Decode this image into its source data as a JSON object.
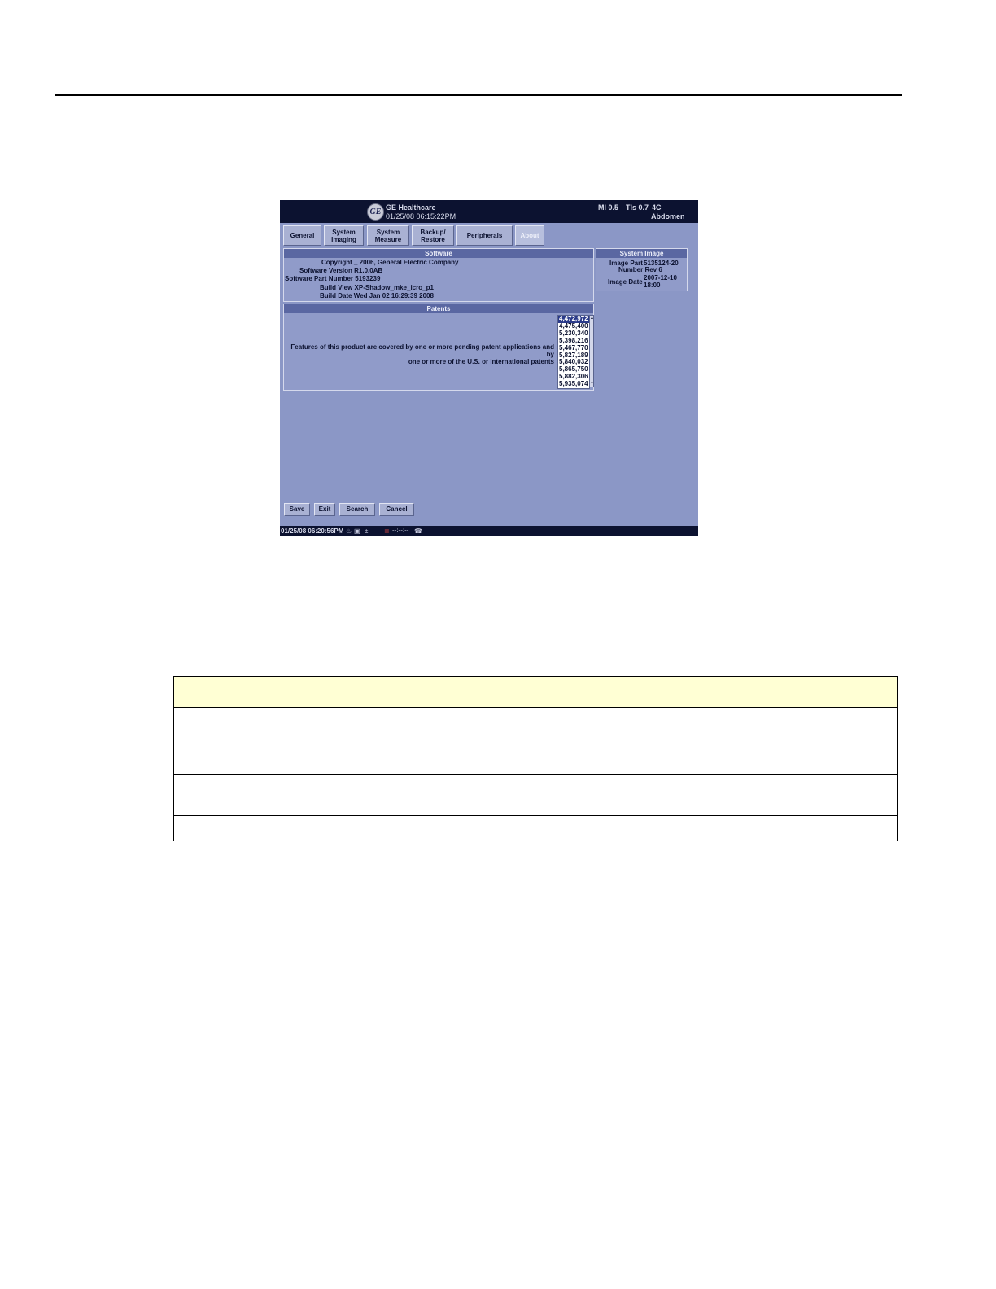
{
  "screenshot": {
    "header": {
      "brand": "GE Healthcare",
      "datetime": "01/25/08 06:15:22PM",
      "mi": "MI 0.5",
      "tis": "TIs 0.7",
      "probe": "4C",
      "preset": "Abdomen",
      "logo": "GE"
    },
    "tabs": [
      {
        "label": "General",
        "active": false
      },
      {
        "label": "System\nImaging",
        "active": false
      },
      {
        "label": "System\nMeasure",
        "active": false
      },
      {
        "label": "Backup/\nRestore",
        "active": false
      },
      {
        "label": "Peripherals",
        "active": false
      },
      {
        "label": "About",
        "active": true
      }
    ],
    "software": {
      "title": "Software",
      "copyright": "Copyright _ 2006, General Electric Company",
      "version": "Software Version R1.0.0AB",
      "part_number": "Software Part Number 5193239",
      "build_view": "Build View XP-Shadow_mke_icro_p1",
      "build_date": "Build Date Wed Jan 02 16:29:39 2008"
    },
    "patents": {
      "title": "Patents",
      "note_line1": "Features of this product are covered by one or more pending patent applications and by",
      "note_line2": "one or more of the U.S. or international patents",
      "list": [
        "4,472,972",
        "4,475,400",
        "5,230,340",
        "5,398,216",
        "5,467,770",
        "5,827,189",
        "5,840,032",
        "5,865,750",
        "5,882,306",
        "5,935,074"
      ]
    },
    "system_image": {
      "title": "System Image",
      "part_label_line1": "Image Part",
      "part_value": "5135124-20",
      "part_label_line2": "Number Rev 6",
      "date_label": "Image Date",
      "date_value_line1": "2007-12-10",
      "date_value_line2": "18:00"
    },
    "buttons": {
      "save": "Save",
      "exit": "Exit",
      "search": "Search",
      "cancel": "Cancel"
    },
    "status": {
      "datetime": "01/25/08 06:20:56PM",
      "dashes": "--:--:--"
    }
  },
  "colors": {
    "screen_background": "#8b97c6",
    "title_bar": "#0c1230",
    "table_header": "#ffffd4"
  }
}
